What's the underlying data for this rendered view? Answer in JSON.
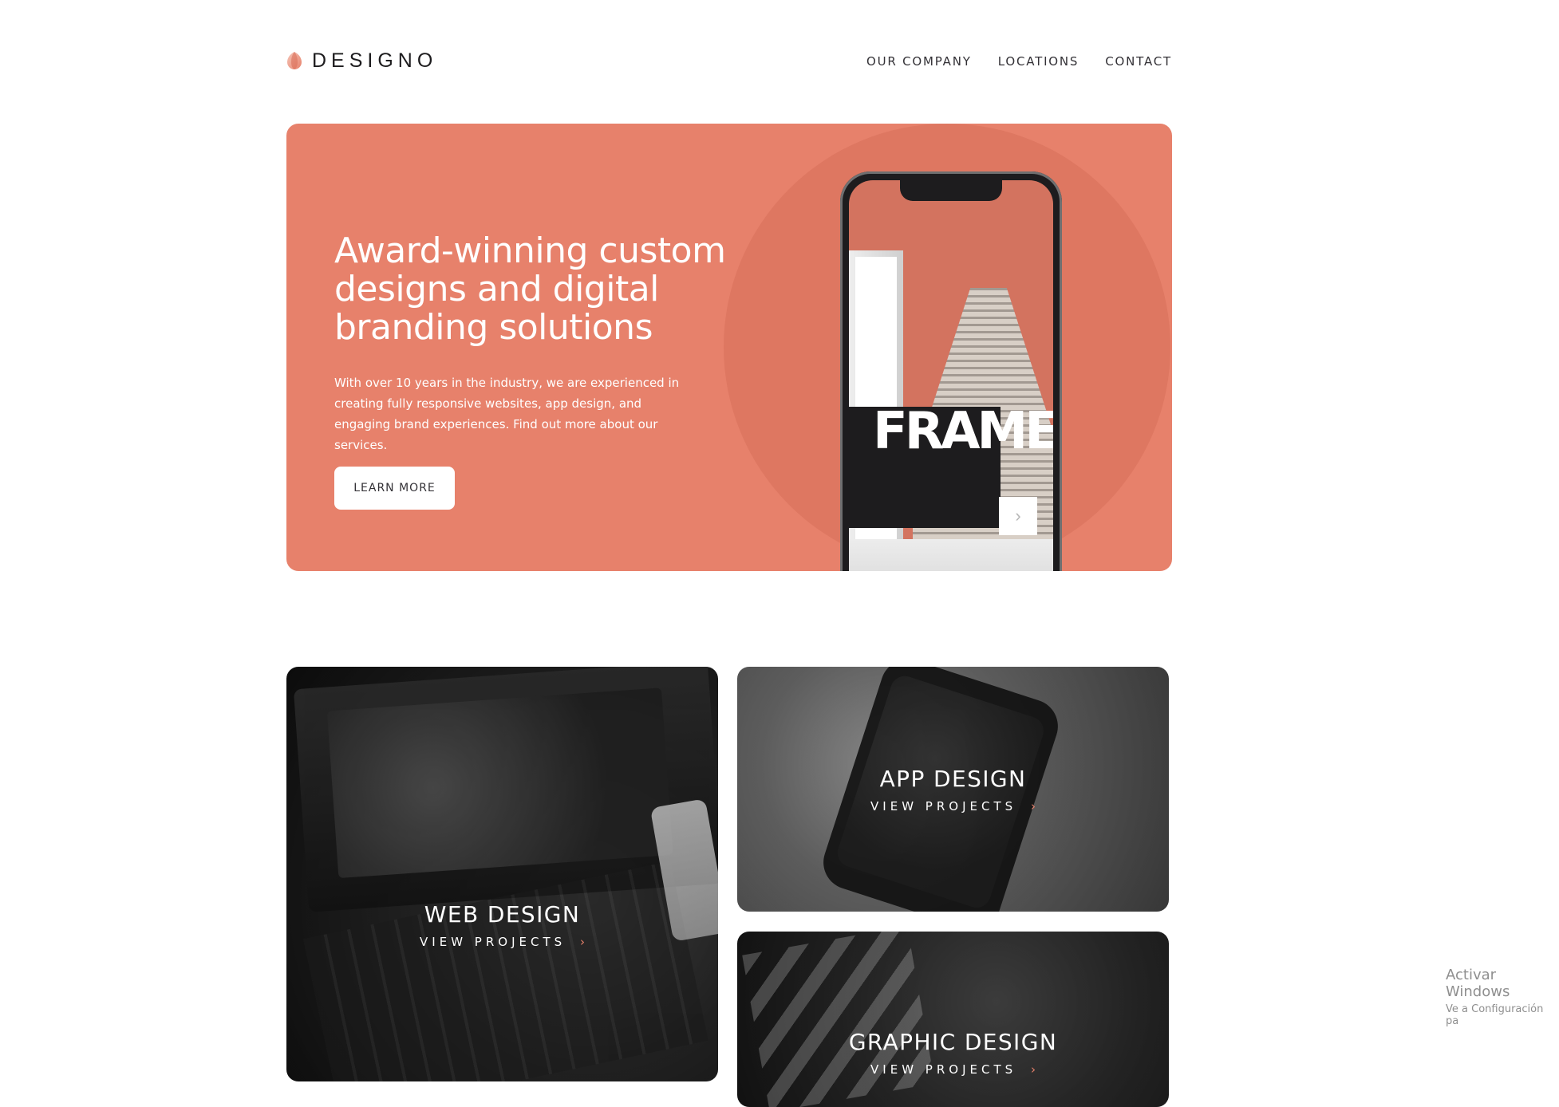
{
  "header": {
    "logo_text": "DESIGNO",
    "nav": [
      {
        "label": "OUR COMPANY"
      },
      {
        "label": "LOCATIONS"
      },
      {
        "label": "CONTACT"
      }
    ]
  },
  "hero": {
    "title": "Award-winning custom designs and digital branding solutions",
    "description": "With over 10 years in the industry, we are experienced in creating fully responsive websites, app design, and engaging brand experiences. Find out more about our services.",
    "cta_label": "LEARN MORE",
    "phone": {
      "brand_text": "FRAME",
      "next_icon": "chevron-right-icon"
    }
  },
  "projects": [
    {
      "title": "WEB DESIGN",
      "link_label": "VIEW PROJECTS"
    },
    {
      "title": "APP DESIGN",
      "link_label": "VIEW PROJECTS"
    },
    {
      "title": "GRAPHIC DESIGN",
      "link_label": "VIEW PROJECTS"
    }
  ],
  "system_watermark": {
    "title": "Activar Windows",
    "subtitle": "Ve a Configuración pa"
  },
  "colors": {
    "accent": "#e7816b",
    "text_dark": "#1d1c1e",
    "white": "#ffffff"
  }
}
